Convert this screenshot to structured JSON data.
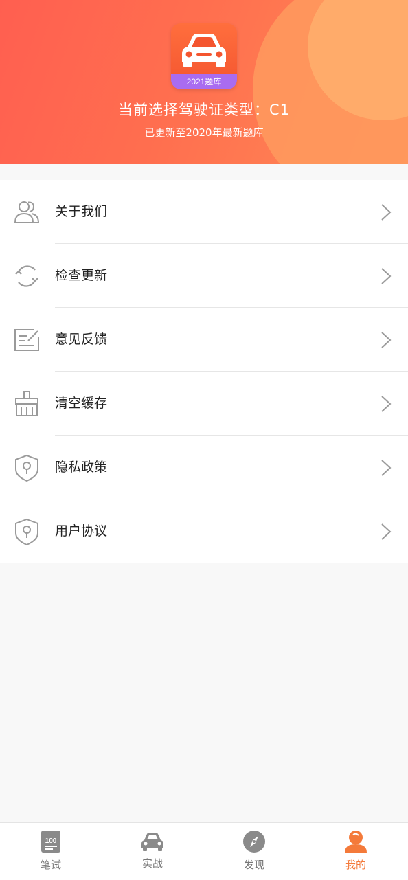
{
  "header": {
    "app_icon_badge": "2021题库",
    "license_line": "当前选择驾驶证类型：C1",
    "update_line": "已更新至2020年最新题库",
    "colors": {
      "gradient_start": "#ff5f50",
      "gradient_end": "#ff8a55",
      "badge": "#a96cf0"
    }
  },
  "menu": {
    "items": [
      {
        "label": "关于我们",
        "icon": "users-icon"
      },
      {
        "label": "检查更新",
        "icon": "refresh-icon"
      },
      {
        "label": "意见反馈",
        "icon": "feedback-icon"
      },
      {
        "label": "清空缓存",
        "icon": "broom-icon"
      },
      {
        "label": "隐私政策",
        "icon": "shield-lock-icon"
      },
      {
        "label": "用户协议",
        "icon": "shield-lock-icon"
      }
    ]
  },
  "tabbar": {
    "active_color": "#f47a3a",
    "tabs": [
      {
        "label": "笔试",
        "icon": "exam-icon",
        "active": false
      },
      {
        "label": "实战",
        "icon": "car-icon",
        "active": false
      },
      {
        "label": "发现",
        "icon": "compass-icon",
        "active": false
      },
      {
        "label": "我的",
        "icon": "person-icon",
        "active": true
      }
    ]
  }
}
